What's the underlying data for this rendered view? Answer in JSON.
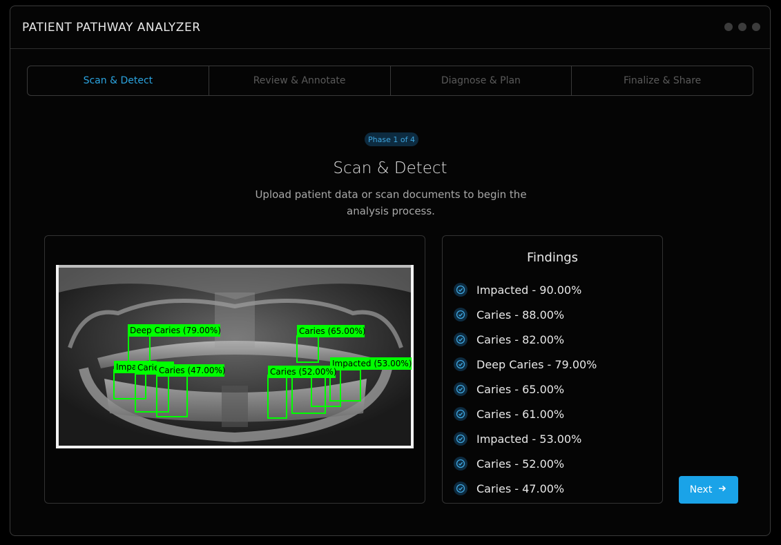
{
  "app": {
    "title": "PATIENT PATHWAY ANALYZER"
  },
  "tabs": [
    {
      "label": "Scan & Detect",
      "active": true
    },
    {
      "label": "Review & Annotate",
      "active": false
    },
    {
      "label": "Diagnose & Plan",
      "active": false
    },
    {
      "label": "Finalize & Share",
      "active": false
    }
  ],
  "phase_badge": "Phase 1 of 4",
  "page": {
    "title": "Scan & Detect",
    "subtitle": "Upload patient data or scan documents to begin the analysis process."
  },
  "detections": [
    {
      "label": "Deep Caries (79.00%)"
    },
    {
      "label": "Caries (65.00%)"
    },
    {
      "label": "Impacted (53.00%)"
    },
    {
      "label": "Caries (52.00%)"
    },
    {
      "label": "Caries (47.00%)"
    },
    {
      "label": "Impacted"
    },
    {
      "label": "Caries"
    }
  ],
  "findings": {
    "title": "Findings",
    "items": [
      "Impacted - 90.00%",
      "Caries - 88.00%",
      "Caries - 82.00%",
      "Deep Caries - 79.00%",
      "Caries - 65.00%",
      "Caries - 61.00%",
      "Impacted - 53.00%",
      "Caries - 52.00%",
      "Caries - 47.00%"
    ]
  },
  "buttons": {
    "next_label": "Next"
  },
  "colors": {
    "accent": "#1aa3e8",
    "detection": "#00ff00",
    "badge_bg": "#0d2b40"
  },
  "icons": {
    "finding": "check-circle-icon",
    "next": "arrow-right-icon",
    "window_controls": "dot-icon"
  }
}
